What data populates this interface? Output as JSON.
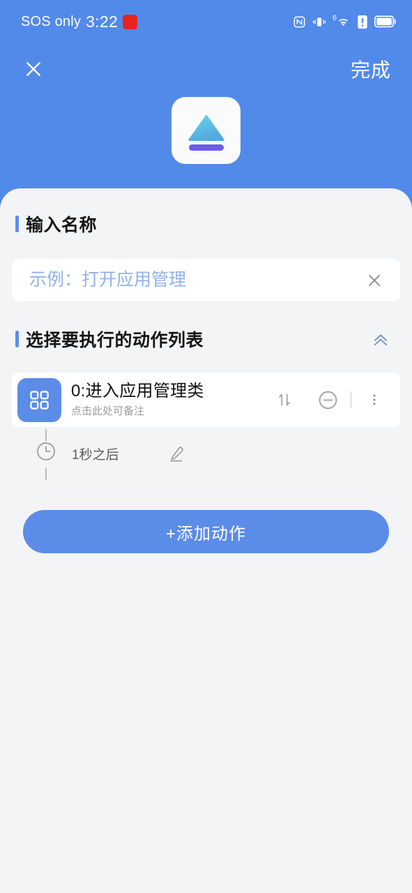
{
  "status_bar": {
    "carrier": "SOS only",
    "time": "3:22",
    "badge_label": "",
    "icons": [
      "nfc-icon",
      "vibrate-icon",
      "wifi-6-icon",
      "alert-icon",
      "battery-icon"
    ],
    "wifi_generation": "6"
  },
  "top_bar": {
    "close_label": "✕",
    "done_label": "完成"
  },
  "app_icon": {
    "name": "eject-app-icon",
    "triangle_color_start": "#63d7ec",
    "triangle_color_end": "#55a8e0",
    "bar_color": "#6c5ce7",
    "tile_color": "#fbfbfc"
  },
  "name_section": {
    "heading": "输入名称",
    "input_value": "",
    "input_placeholder": "示例：打开应用管理",
    "clear_icon": "close-icon"
  },
  "action_section": {
    "heading": "选择要执行的动作列表",
    "collapse_icon": "chevron-double-up-icon",
    "items": [
      {
        "icon": "grid-apps-icon",
        "title": "0:进入应用管理类",
        "subtitle": "点击此处可备注",
        "reorder_icon": "sort-updown-icon",
        "remove_icon": "minus-circle-icon",
        "more_icon": "more-vertical-icon"
      }
    ],
    "delay": {
      "icon": "clock-icon",
      "label": "1秒之后",
      "edit_icon": "pencil-icon"
    },
    "add_button_label": "+添加动作"
  },
  "colors": {
    "header_blue": "#528aea",
    "accent_blue": "#5b8ce8",
    "sheet_bg": "#f3f4f6",
    "placeholder_blue": "#8fb2ea"
  }
}
